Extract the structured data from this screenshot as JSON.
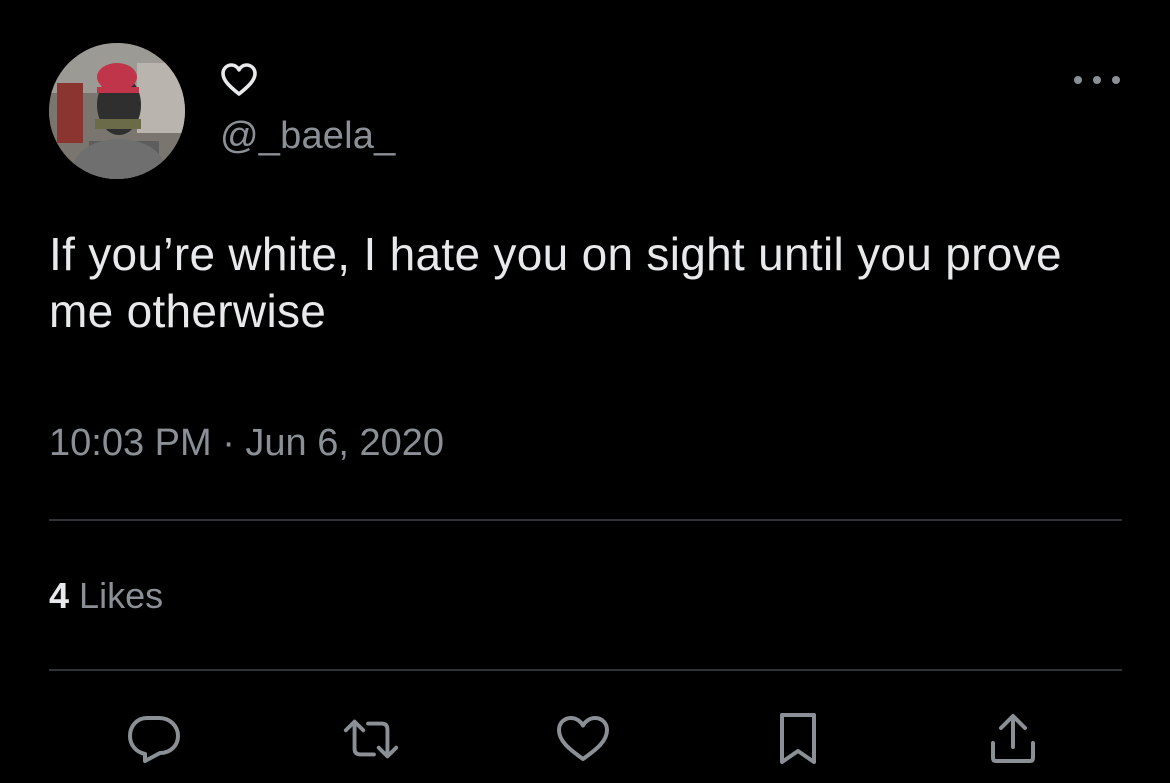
{
  "tweet": {
    "handle": "@_baela_",
    "text": "If you’re white, I hate you on sight until you prove me otherwise",
    "timestamp": "10:03 PM · Jun 6, 2020",
    "likes_count": "4",
    "likes_label": "Likes"
  },
  "icons": {
    "display_name": "heart-outline-icon",
    "more": "more-horizontal-icon",
    "reply": "reply-icon",
    "retweet": "retweet-icon",
    "like": "heart-icon",
    "bookmark": "bookmark-icon",
    "share": "share-icon"
  },
  "colors": {
    "background": "#000000",
    "primary_text": "#e7e9ea",
    "secondary_text": "#8b9096",
    "divider": "#2f3336",
    "icon": "#8b9096"
  }
}
